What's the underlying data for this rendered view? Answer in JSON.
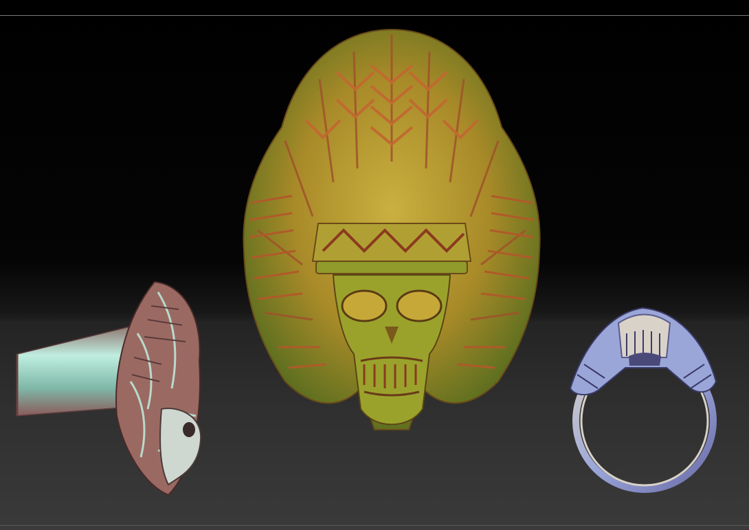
{
  "scene": {
    "views": [
      {
        "id": "side-view",
        "material": "teal-rose"
      },
      {
        "id": "front-view",
        "material": "gold-green"
      },
      {
        "id": "edge-view",
        "material": "blue-silver"
      }
    ]
  },
  "colors": {
    "gold_light": "#c9b040",
    "gold_mid": "#a88a28",
    "green_shadow": "#4f6a1e",
    "copper": "#b0582a",
    "teal_light": "#bfeee0",
    "teal_mid": "#7fb8a8",
    "rose": "#9a6a62",
    "silver_blue": "#9aa6d8",
    "silver_pale": "#d9d2c8"
  }
}
